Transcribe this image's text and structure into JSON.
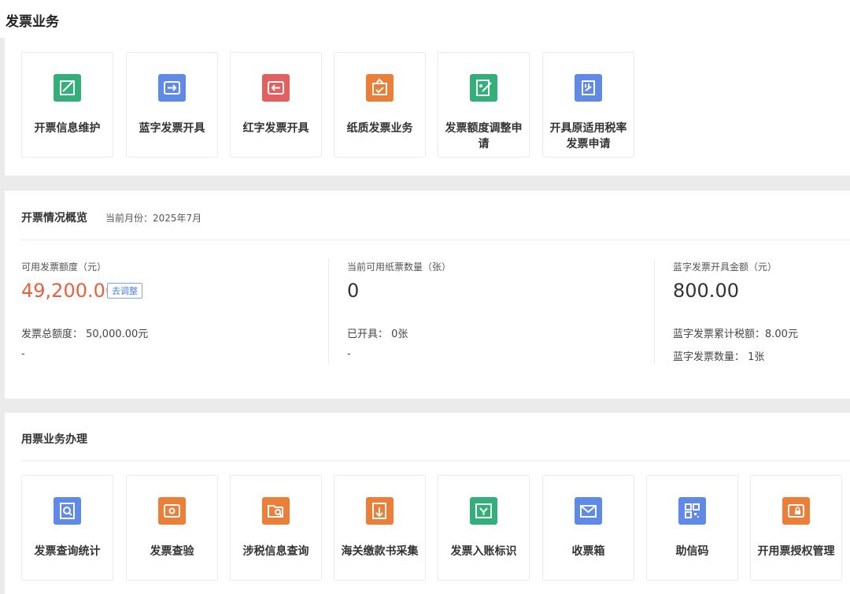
{
  "page_title": "发票业务",
  "top_tiles": [
    {
      "label": "开票信息维护",
      "icon": "edit-doc-icon",
      "color": "#33b07a"
    },
    {
      "label": "蓝字发票开具",
      "icon": "invoice-in-icon",
      "color": "#5f8ae8"
    },
    {
      "label": "红字发票开具",
      "icon": "invoice-out-icon",
      "color": "#e26060"
    },
    {
      "label": "纸质发票业务",
      "icon": "paper-invoice-icon",
      "color": "#eb7f39"
    },
    {
      "label": "发票额度调整申请",
      "icon": "quota-edit-icon",
      "color": "#33b07a"
    },
    {
      "label": "开具原适用税率发票申请",
      "icon": "tax-rate-doc-icon",
      "color": "#5f8ae8"
    }
  ],
  "overview": {
    "title": "开票情况概览",
    "month_label": "当前月份：2025年7月",
    "quota": {
      "label": "可用发票额度（元）",
      "value": "49,200.00",
      "adjust_label": "去调整",
      "total_line": "发票总额度：  50,000.00元",
      "extra": "-"
    },
    "paper": {
      "label": "当前可用纸票数量（张）",
      "value": "0",
      "issued_line": "已开具：  0张",
      "extra": "-"
    },
    "blue": {
      "label": "蓝字发票开具金额（元）",
      "value": "800.00",
      "tax_line": "蓝字发票累计税额：8.00元",
      "count_line": "蓝字发票数量：  1张"
    }
  },
  "services": {
    "title": "用票业务办理",
    "tiles": [
      {
        "label": "发票查询统计",
        "icon": "search-doc-icon",
        "color": "#5f8ae8"
      },
      {
        "label": "发票查验",
        "icon": "ticket-check-icon",
        "color": "#eb7f39"
      },
      {
        "label": "涉税信息查询",
        "icon": "search-folder-icon",
        "color": "#eb7f39"
      },
      {
        "label": "海关缴款书采集",
        "icon": "customs-doc-icon",
        "color": "#eb7f39"
      },
      {
        "label": "发票入账标识",
        "icon": "account-mark-icon",
        "color": "#33b07a"
      },
      {
        "label": "收票箱",
        "icon": "mail-icon",
        "color": "#5f8ae8"
      },
      {
        "label": "助信码",
        "icon": "qr-code-icon",
        "color": "#5f8ae8"
      },
      {
        "label": "开用票授权管理",
        "icon": "lock-ticket-icon",
        "color": "#eb7f39"
      }
    ]
  }
}
